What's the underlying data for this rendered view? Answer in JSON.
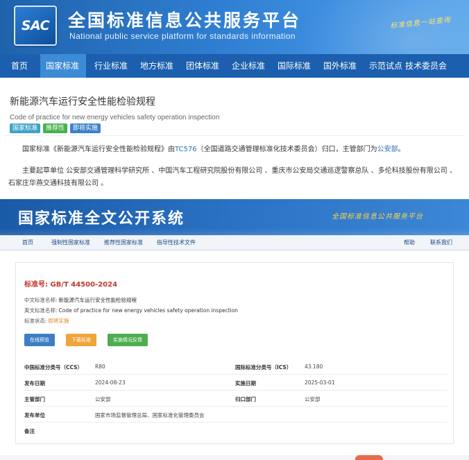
{
  "portal": {
    "logo_text": "SAC",
    "title": "全国标准信息公共服务平台",
    "subtitle": "National public service platform  for standards information",
    "slogan": "标准信息一站查询"
  },
  "main_nav": [
    {
      "label": "首页"
    },
    {
      "label": "国家标准",
      "active": true
    },
    {
      "label": "行业标准"
    },
    {
      "label": "地方标准"
    },
    {
      "label": "团体标准"
    },
    {
      "label": "企业标准"
    },
    {
      "label": "国际标准"
    },
    {
      "label": "国外标准"
    },
    {
      "label": "示范试点"
    },
    {
      "label": "技术委员会"
    }
  ],
  "standard": {
    "title": "新能源汽车运行安全性能检验规程",
    "title_en": "Code of practice for new energy vehicles safety operation inspection",
    "badges": [
      "国家标准",
      "推荐性",
      "即将实施"
    ],
    "desc_prefix": "国家标准《新能源汽车运行安全性能检验规程》由",
    "desc_tc": "TC576",
    "desc_middle": "（全国道路交通管理标准化技术委员会）归口，主管部门为",
    "desc_dept": "公安部",
    "desc_end": "。",
    "drafters": "主要起草单位 公安部交通管理科学研究所 、中国汽车工程研究院股份有限公司 、重庆市公安局交通巡逻警察总队 、多伦科技股份有限公司 、石家庄华燕交通科技有限公司 。"
  },
  "system": {
    "title": "国家标准全文公开系统",
    "slogan": "全国标准信息公共服务平台"
  },
  "sub_nav": {
    "items": [
      "首页",
      "强制性国家标准",
      "推荐性国家标准",
      "指导性技术文件"
    ],
    "right": [
      "帮助",
      "联系我们"
    ]
  },
  "detail": {
    "std_no_label": "标准号:",
    "std_no": "GB/T 44500-2024",
    "cn_name_label": "中文标准名称:",
    "cn_name": "新能源汽车运行安全性能检验规程",
    "en_name_label": "英文标准名称:",
    "en_name": "Code of practice for new energy vehicles safety operation inspection",
    "status_label": "标准状态:",
    "status": "即将实施",
    "buttons": {
      "preview": "在线预览",
      "download": "下载标准",
      "feedback": "实施情况反馈"
    },
    "table": {
      "ccs_label": "中国标准分类号（CCS）",
      "ccs": "R80",
      "ics_label": "国际标准分类号（ICS）",
      "ics": "43.180",
      "pub_date_label": "发布日期",
      "pub_date": "2024-08-23",
      "impl_date_label": "实施日期",
      "impl_date": "2025-03-01",
      "authority_label": "主管部门",
      "authority": "公安部",
      "tc_label": "归口部门",
      "tc": "公安部",
      "publisher_label": "发布单位",
      "publisher": "国家市场监督管理总局、国家标准化管理委员会",
      "remark_label": "备注"
    }
  }
}
